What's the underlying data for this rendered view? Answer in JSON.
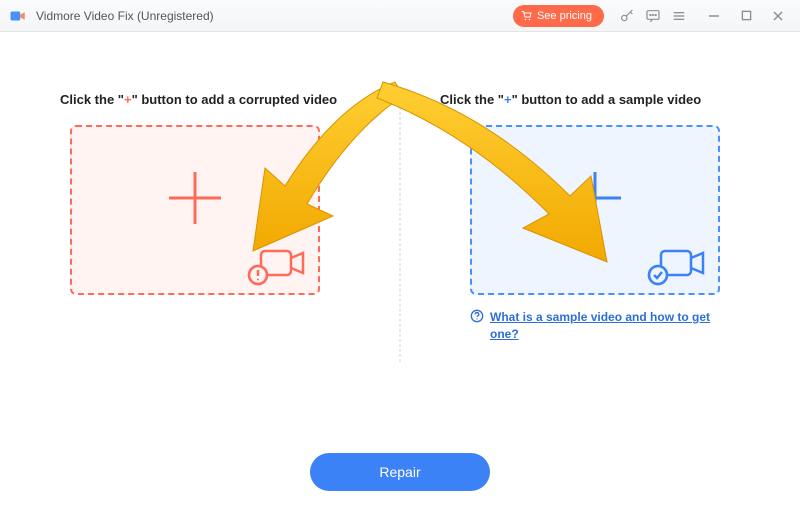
{
  "app": {
    "title": "Vidmore Video Fix (Unregistered)"
  },
  "header": {
    "pricing_label": "See pricing"
  },
  "left": {
    "label_prefix": "Click the \"",
    "label_plus": "+",
    "label_suffix": "\" button to add a corrupted video"
  },
  "right": {
    "label_prefix": "Click the \"",
    "label_plus": "+",
    "label_suffix": "\" button to add a sample video"
  },
  "help": {
    "text": "What is a sample video and how to get one?"
  },
  "actions": {
    "repair": "Repair"
  }
}
